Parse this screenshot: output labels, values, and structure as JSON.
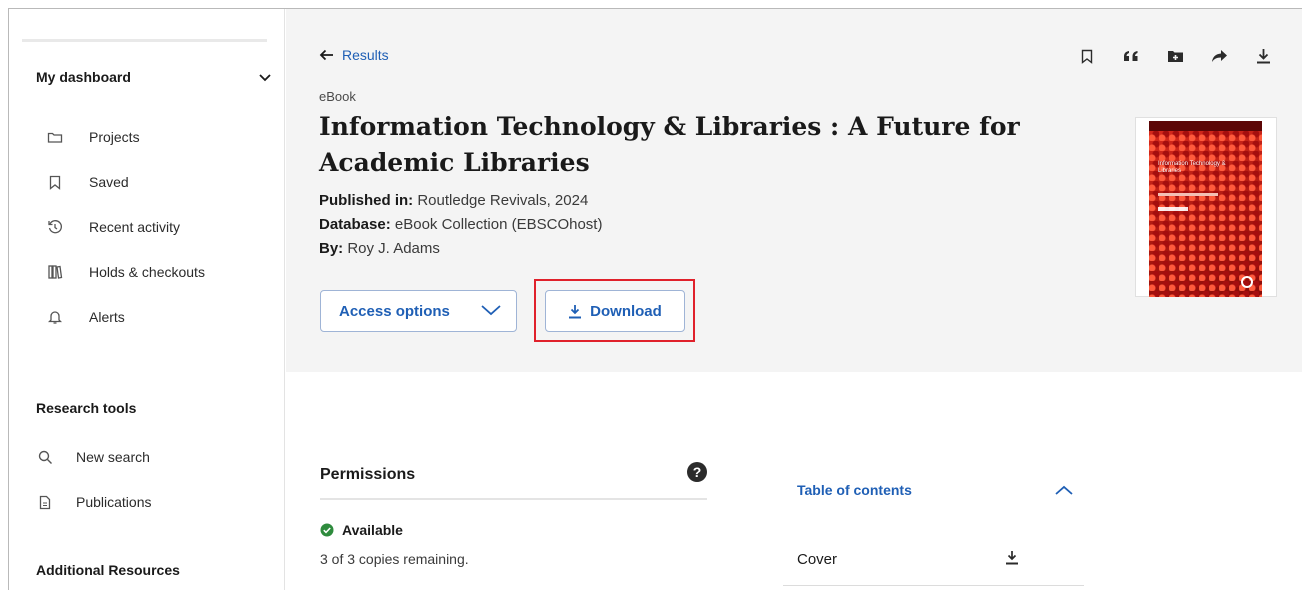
{
  "sidebar": {
    "dashboard_label": "My dashboard",
    "items": [
      {
        "label": "Projects",
        "icon": "folder-icon"
      },
      {
        "label": "Saved",
        "icon": "bookmark-icon"
      },
      {
        "label": "Recent activity",
        "icon": "history-icon"
      },
      {
        "label": "Holds & checkouts",
        "icon": "books-icon"
      },
      {
        "label": "Alerts",
        "icon": "bell-icon"
      }
    ],
    "research_tools_title": "Research tools",
    "research_items": [
      {
        "label": "New search",
        "icon": "search-icon"
      },
      {
        "label": "Publications",
        "icon": "document-icon"
      }
    ],
    "additional_title": "Additional Resources"
  },
  "record": {
    "back_label": "Results",
    "type": "eBook",
    "title": "Information Technology & Libraries : A Future for Academic Libraries",
    "published_label": "Published in:",
    "published_value": "Routledge Revivals, 2024",
    "database_label": "Database:",
    "database_value": "eBook Collection (EBSCOhost)",
    "by_label": "By:",
    "by_value": "Roy J. Adams",
    "access_label": "Access options",
    "download_label": "Download",
    "toolbar_icons": [
      "bookmark-icon",
      "quote-icon",
      "folder-add-icon",
      "share-icon",
      "download-icon"
    ],
    "cover": {
      "title": "Information Technology & Libraries",
      "colors": {
        "primary": "#c41f12",
        "dark": "#5c0606"
      }
    }
  },
  "permissions": {
    "title": "Permissions",
    "help": "?",
    "status": "Available",
    "copies": "3 of 3 copies remaining."
  },
  "toc": {
    "title": "Table of contents",
    "rows": [
      {
        "label": "Cover"
      }
    ]
  },
  "colors": {
    "accent": "#1f5fb5",
    "highlight": "#e0212b",
    "success": "#2e8b3d"
  }
}
